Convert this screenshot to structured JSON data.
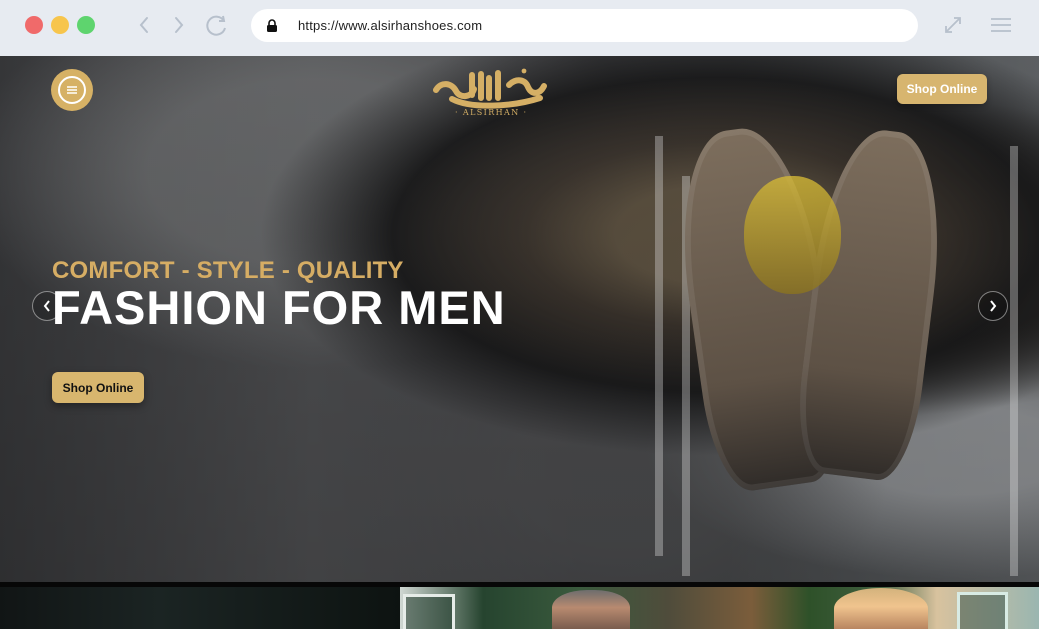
{
  "browser": {
    "url": "https://www.alsirhanshoes.com",
    "icons": [
      "back-icon",
      "forward-icon",
      "reload-icon",
      "lock-icon",
      "expand-icon",
      "menu-icon"
    ]
  },
  "site": {
    "brand_latin": "· ALSIRHAN ·",
    "top_button": "Shop Online",
    "hero": {
      "subtitle": "COMFORT - STYLE - QUALITY",
      "title": "FASHION FOR MEN",
      "button": "Shop Online"
    },
    "colors": {
      "accent": "#d7b56f",
      "logo": "#d5af65"
    }
  }
}
